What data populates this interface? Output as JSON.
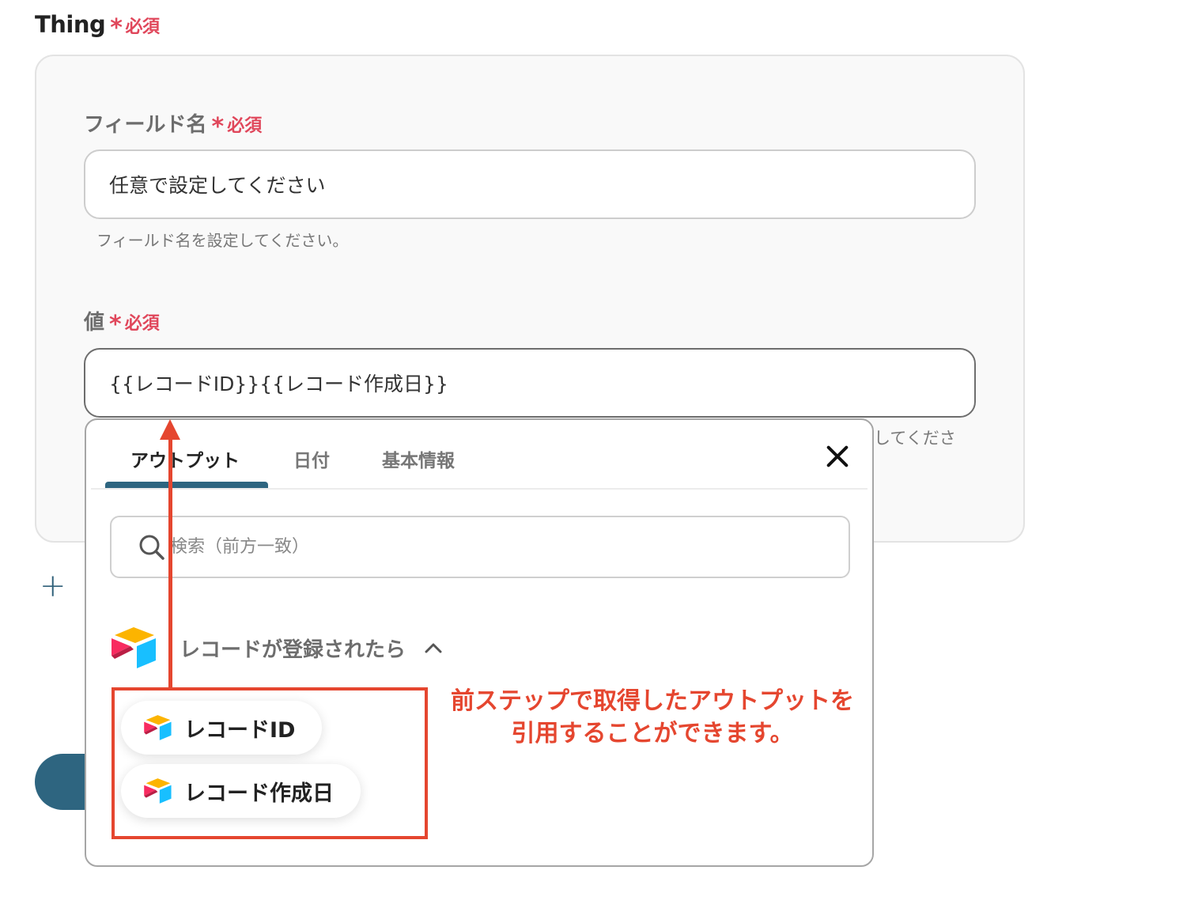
{
  "section": {
    "title": "Thing",
    "required_star": "*",
    "required_text": "必須"
  },
  "field_name": {
    "label": "フィールド名",
    "required_star": "*",
    "required_text": "必須",
    "value": "任意で設定してください",
    "help": "フィールド名を設定してください。"
  },
  "value_field": {
    "label": "値",
    "required_star": "*",
    "required_text": "必須",
    "value": "{{レコードID}}{{レコード作成日}}",
    "help_partial": "してくださ"
  },
  "add_button": {
    "icon": "+"
  },
  "popup": {
    "tabs": [
      {
        "label": "アウトプット"
      },
      {
        "label": "日付"
      },
      {
        "label": "基本情報"
      }
    ],
    "search_placeholder": "検索（前方一致）",
    "group": {
      "label": "レコードが登録されたら",
      "icon": "airtable-icon",
      "chevron": "chevron-up-icon"
    },
    "items": [
      {
        "label": "レコードID"
      },
      {
        "label": "レコード作成日"
      }
    ]
  },
  "annotation": {
    "line1": "前ステップで取得したアウトプットを",
    "line2": "引用することができます。",
    "color": "#e5462f"
  },
  "colors": {
    "accent": "#2e6580",
    "required": "#e0475b"
  }
}
